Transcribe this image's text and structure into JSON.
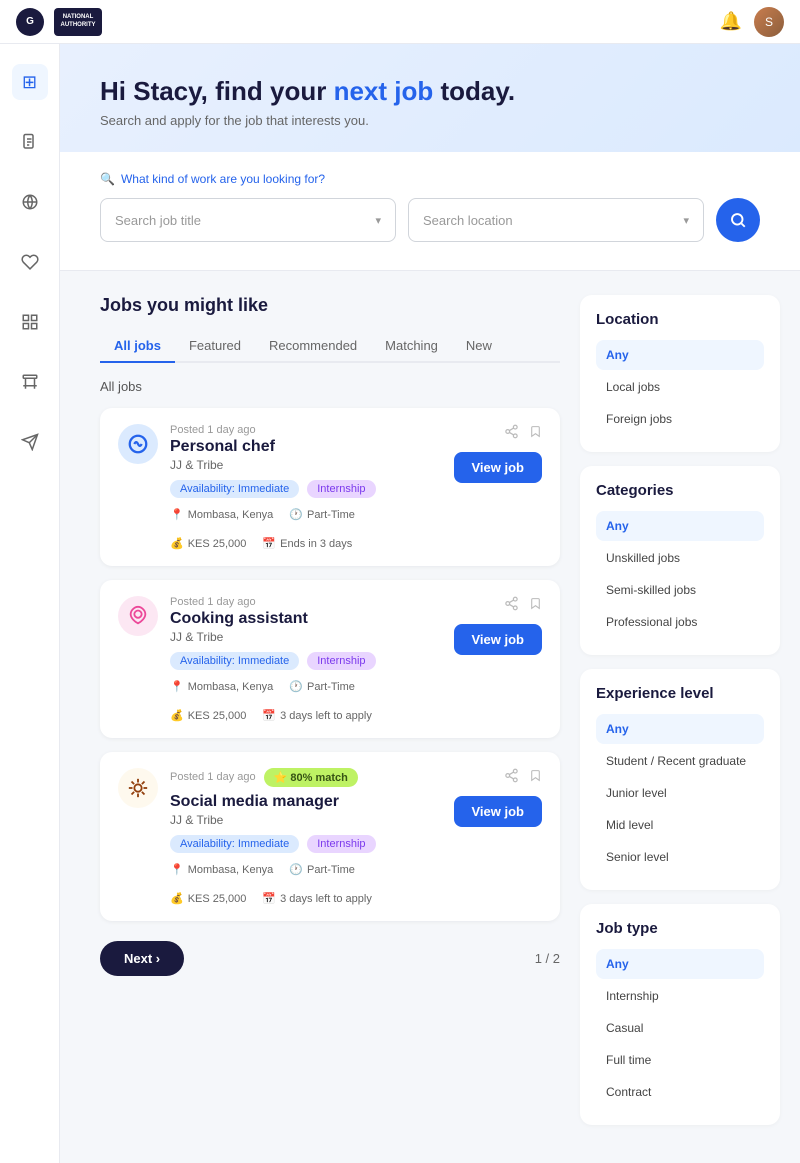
{
  "topNav": {
    "logoCircleText": "G",
    "logoBoxText": "NATIONAL\nAUTHORITY",
    "bellLabel": "notifications",
    "avatarLabel": "Stacy"
  },
  "sidebar": {
    "items": [
      {
        "name": "dashboard",
        "icon": "⊞",
        "active": true
      },
      {
        "name": "document",
        "icon": "📄",
        "active": false
      },
      {
        "name": "globe",
        "icon": "◎",
        "active": false
      },
      {
        "name": "heart",
        "icon": "♡",
        "active": false
      },
      {
        "name": "grid",
        "icon": "⊟",
        "active": false
      },
      {
        "name": "person",
        "icon": "👤",
        "active": false
      },
      {
        "name": "send",
        "icon": "✈",
        "active": false
      }
    ]
  },
  "hero": {
    "greetingPrefix": "Hi Stacy, find your ",
    "greetingHighlight": "next job",
    "greetingSuffix": " today.",
    "subtitle": "Search and apply for the job that interests you."
  },
  "search": {
    "hint": "What kind of work are you looking for?",
    "jobTitlePlaceholder": "Search job title",
    "locationPlaceholder": "Search location",
    "searchButtonLabel": "Search"
  },
  "jobsSection": {
    "title": "Jobs you might like",
    "tabs": [
      {
        "label": "All jobs",
        "active": true
      },
      {
        "label": "Featured",
        "active": false
      },
      {
        "label": "Recommended",
        "active": false
      },
      {
        "label": "Matching",
        "active": false
      },
      {
        "label": "New",
        "active": false
      }
    ],
    "allJobsLabel": "All jobs",
    "jobs": [
      {
        "id": 1,
        "posted": "Posted 1 day ago",
        "title": "Personal chef",
        "company": "JJ & Tribe",
        "tags": [
          "Availability: Immediate",
          "Internship"
        ],
        "location": "Mombasa, Kenya",
        "type": "Part-Time",
        "salary": "KES 25,000",
        "deadline": "Ends in 3 days",
        "logoType": "blue",
        "logoIcon": "🍳",
        "matchBadge": null
      },
      {
        "id": 2,
        "posted": "Posted 1 day ago",
        "title": "Cooking assistant",
        "company": "JJ & Tribe",
        "tags": [
          "Availability: Immediate",
          "Internship"
        ],
        "location": "Mombasa, Kenya",
        "type": "Part-Time",
        "salary": "KES 25,000",
        "deadline": "3 days left to apply",
        "logoType": "pink",
        "logoIcon": "🌀",
        "matchBadge": null
      },
      {
        "id": 3,
        "posted": "Posted 1 day ago",
        "title": "Social media manager",
        "company": "JJ & Tribe",
        "tags": [
          "Availability: Immediate",
          "Internship"
        ],
        "location": "Mombasa, Kenya",
        "type": "Part-Time",
        "salary": "KES 25,000",
        "deadline": "3 days left to apply",
        "logoType": "brown",
        "logoIcon": "✳",
        "matchBadge": "80% match"
      }
    ],
    "nextButton": "Next ›",
    "pageInfo": "1 / 2"
  },
  "filters": {
    "location": {
      "title": "Location",
      "options": [
        "Any",
        "Local jobs",
        "Foreign jobs"
      ]
    },
    "categories": {
      "title": "Categories",
      "options": [
        "Any",
        "Unskilled jobs",
        "Semi-skilled jobs",
        "Professional jobs"
      ]
    },
    "experience": {
      "title": "Experience level",
      "options": [
        "Any",
        "Student / Recent graduate",
        "Junior level",
        "Mid level",
        "Senior level"
      ]
    },
    "jobType": {
      "title": "Job type",
      "options": [
        "Any",
        "Internship",
        "Casual",
        "Full time",
        "Contract"
      ]
    }
  }
}
